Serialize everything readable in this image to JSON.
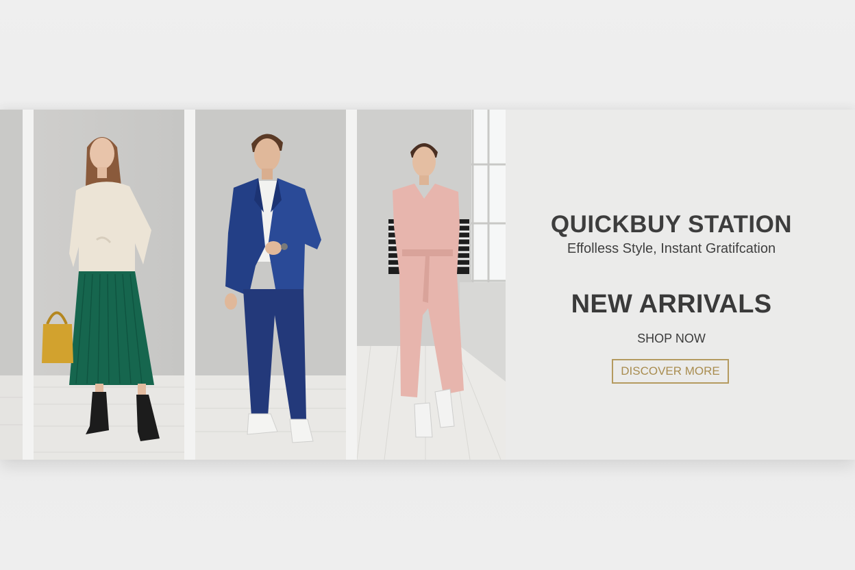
{
  "brand": {
    "name": "QUICKBUY STATION",
    "tagline": "Effolless Style, Instant Gratifcation"
  },
  "promo": {
    "headline": "NEW ARRIVALS",
    "shop_now_label": "SHOP NOW",
    "discover_button_label": "DISCOVER MORE"
  },
  "images": [
    {
      "name": "model-green-skirt-photo",
      "icon": "woman-green-pleated-skirt-photo"
    },
    {
      "name": "model-blue-suit-photo",
      "icon": "man-navy-suit-photo"
    },
    {
      "name": "model-pink-jumpsuit-photo",
      "icon": "woman-pink-jumpsuit-photo"
    }
  ],
  "colors": {
    "background": "#ececeb",
    "headline_text": "#3a3a3a",
    "accent_gold": "#b49a5f",
    "skirt_green": "#16664e",
    "suit_navy": "#233f86",
    "jumpsuit_pink": "#e7b5ad"
  }
}
